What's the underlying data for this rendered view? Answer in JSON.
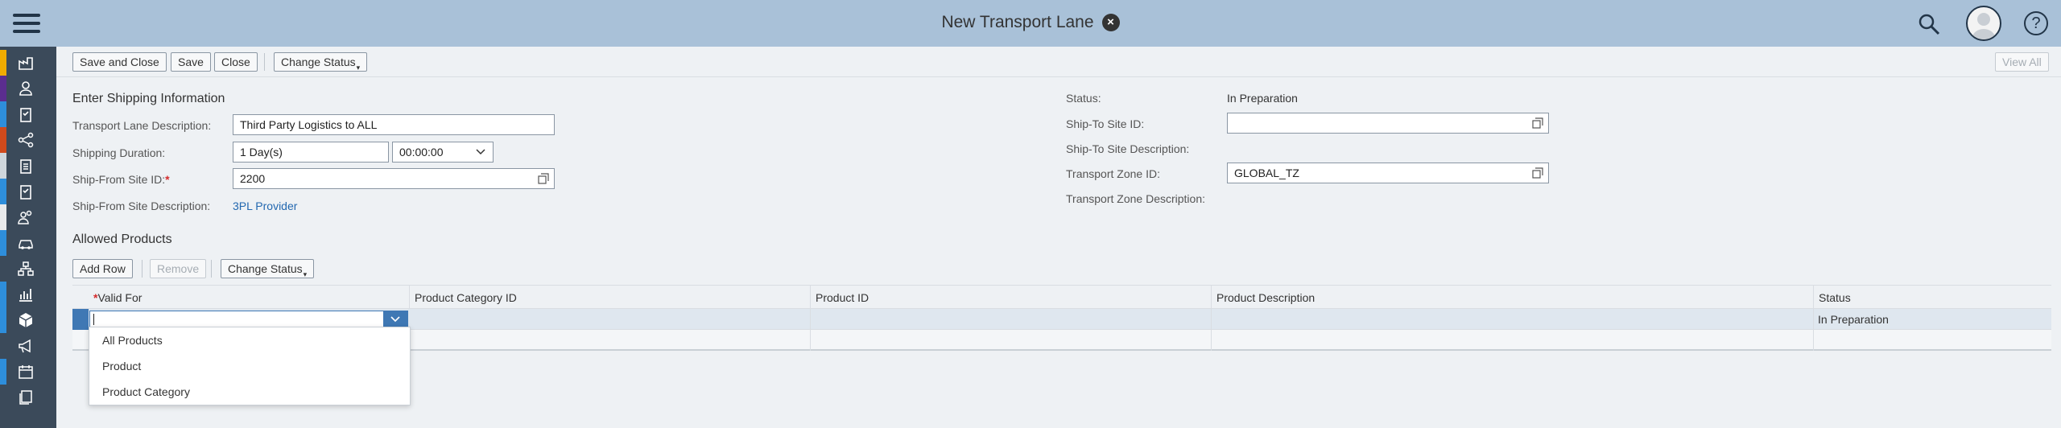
{
  "shell": {
    "title": "New Transport Lane",
    "close_symbol": "×",
    "help_symbol": "?",
    "icons": [
      "menu-icon",
      "search-icon",
      "avatar",
      "help-icon"
    ]
  },
  "sidebar": {
    "items": [
      {
        "icon": "factory-icon",
        "strip_color": "#f0ab00"
      },
      {
        "icon": "user-icon",
        "strip_color": "#5b2d8f"
      },
      {
        "icon": "clipboard-icon",
        "strip_color": "#2e8edb"
      },
      {
        "icon": "share-icon",
        "strip_color": "#d04a1c"
      },
      {
        "icon": "clipboard-icon",
        "strip_color": "#cfd6dc"
      },
      {
        "icon": "clipboard-icon",
        "strip_color": "#2e8edb"
      },
      {
        "icon": "user-group-icon",
        "strip_color": "#e8eaec"
      },
      {
        "icon": "car-icon",
        "strip_color": "#2e8edb"
      },
      {
        "icon": "org-chart-icon",
        "strip_color": "#3b4a5a"
      },
      {
        "icon": "chart-icon",
        "strip_color": "#2e8edb"
      },
      {
        "icon": "cube-icon",
        "strip_color": "#2e8edb"
      },
      {
        "icon": "megaphone-icon",
        "strip_color": "#3b4a5a"
      },
      {
        "icon": "calendar-icon",
        "strip_color": "#2e8edb"
      },
      {
        "icon": "documents-icon",
        "strip_color": "#3b4a5a"
      }
    ]
  },
  "toolbar": {
    "save_close": "Save and Close",
    "save": "Save",
    "close": "Close",
    "change_status": "Change Status",
    "view_all": "View All"
  },
  "shipping": {
    "section_title": "Enter Shipping Information",
    "lane_desc_label": "Transport Lane Description:",
    "lane_desc_value": "Third Party Logistics to ALL",
    "duration_label": "Shipping Duration:",
    "duration_days": "1 Day(s)",
    "duration_time": "00:00:00",
    "from_site_label": "Ship-From Site ID:",
    "from_site_req": "*",
    "from_site_value": "2200",
    "from_desc_label": "Ship-From Site Description:",
    "from_desc_value": "3PL Provider",
    "status_label": "Status:",
    "status_value": "In Preparation",
    "to_site_label": "Ship-To Site ID:",
    "to_site_value": "",
    "to_desc_label": "Ship-To Site Description:",
    "zone_label": "Transport Zone ID:",
    "zone_value": "GLOBAL_TZ",
    "zone_desc_label": "Transport Zone Description:"
  },
  "products": {
    "section_title": "Allowed Products",
    "add_row": "Add Row",
    "remove": "Remove",
    "change_status": "Change Status",
    "columns": {
      "valid_for_req": "*",
      "valid_for": "Valid For",
      "category": "Product Category ID",
      "product": "Product ID",
      "description": "Product Description",
      "status": "Status"
    },
    "rows": [
      {
        "valid_for": "",
        "status": "In Preparation"
      }
    ],
    "dropdown_options": [
      "All Products",
      "Product",
      "Product Category"
    ]
  }
}
